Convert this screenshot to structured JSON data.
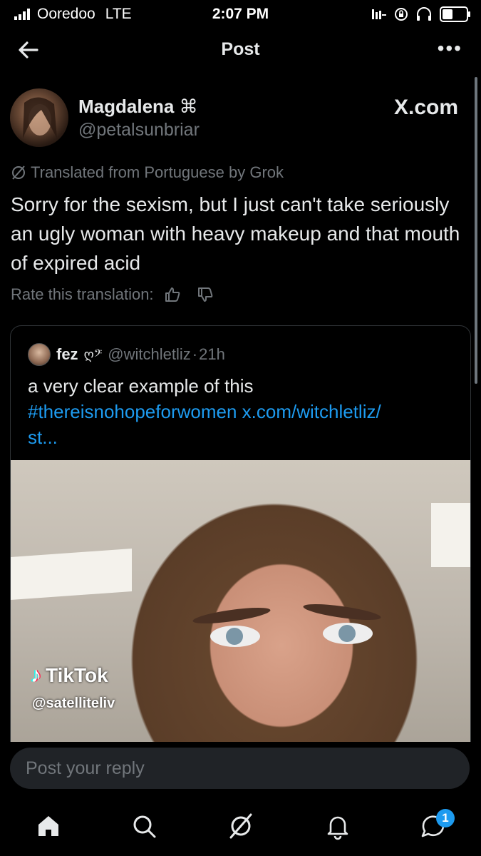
{
  "status_bar": {
    "carrier": "Ooredoo",
    "network": "LTE",
    "time": "2:07 PM"
  },
  "header": {
    "title": "Post",
    "back_icon": "back-arrow-icon",
    "more_icon": "more-icon"
  },
  "post": {
    "author_name": "Magdalena",
    "author_emoji": "⌘",
    "author_handle": "@petalsunbriar",
    "site_label": "X.com",
    "translated_label": "Translated from Portuguese by Grok",
    "text": "Sorry for the sexism, but I just can't take seriously an ugly woman with heavy makeup and that mouth of expired acid",
    "rate_label": "Rate this translation:"
  },
  "quote": {
    "name": "fez",
    "name_emoji": "ღ𝄢",
    "handle": "@witchletliz",
    "separator": "·",
    "time": "21h",
    "text": "a very clear example of this",
    "hashtag": "#thereisnohopeforwomen",
    "link": "x.com/witchletliz/",
    "link_tail": "st...",
    "media": {
      "watermark": "TikTok",
      "watermark_handle": "@satelliteliv"
    }
  },
  "reply": {
    "placeholder": "Post your reply"
  },
  "bottom_nav": {
    "items": [
      "home-icon",
      "search-icon",
      "grok-icon",
      "notifications-icon",
      "messages-icon"
    ],
    "messages_badge": "1"
  },
  "colors": {
    "background": "#000000",
    "text": "#e7e9ea",
    "muted": "#71767b",
    "link": "#1d9bf0"
  }
}
